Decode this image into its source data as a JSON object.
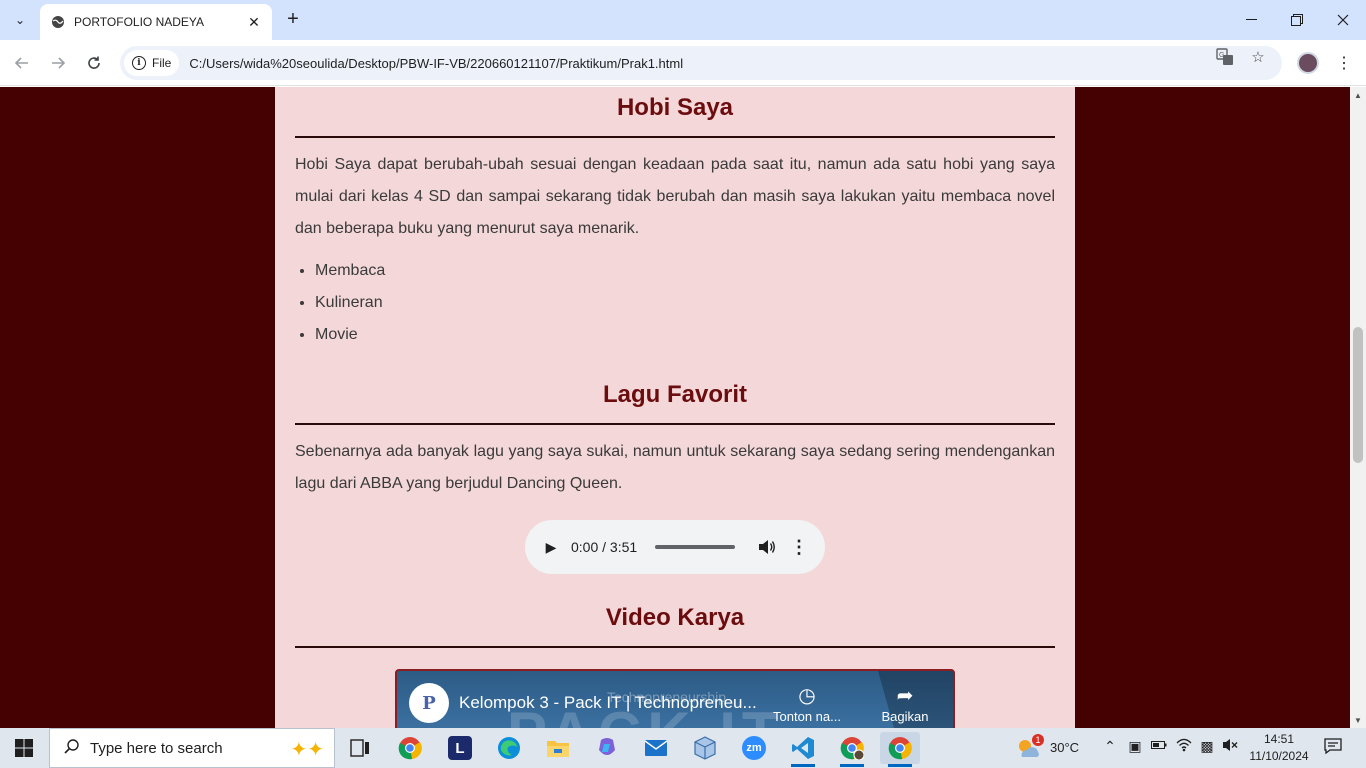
{
  "browser": {
    "tab_title": "PORTOFOLIO NADEYA",
    "address_chip": "File",
    "url": "C:/Users/wida%20seoulida/Desktop/PBW-IF-VB/220660121107/Praktikum/Prak1.html"
  },
  "page": {
    "hobby": {
      "title": "Hobi Saya",
      "paragraph": "Hobi Saya dapat berubah-ubah sesuai dengan keadaan pada saat itu, namun ada satu hobi yang saya mulai dari kelas 4 SD dan sampai sekarang tidak berubah dan masih saya lakukan yaitu membaca novel dan beberapa buku yang menurut saya menarik.",
      "items": [
        "Membaca",
        "Kulineran",
        "Movie"
      ]
    },
    "song": {
      "title": "Lagu Favorit",
      "paragraph": "Sebenarnya ada banyak lagu yang saya sukai, namun untuk sekarang saya sedang sering mendengankan lagu dari ABBA yang berjudul Dancing Queen.",
      "audio_time": "0:00 / 3:51",
      "audio_progress": 0
    },
    "video": {
      "title": "Video Karya",
      "video_title": "Kelompok 3 - Pack IT | Technopreneu...",
      "watch_later": "Tonton na...",
      "share": "Bagikan",
      "channel_initial": "P",
      "background_text": "PACK IT",
      "background_subtext": "Technopreneurship"
    }
  },
  "taskbar": {
    "search_placeholder": "Type here to search",
    "weather": "30°C",
    "weather_badge": "1",
    "time": "14:51",
    "date": "11/10/2024"
  },
  "colors": {
    "page_bg": "#450102",
    "card_bg": "#f4d7d8",
    "heading": "#6b0d0f",
    "chrome_titlebar": "#d3e3fd"
  }
}
